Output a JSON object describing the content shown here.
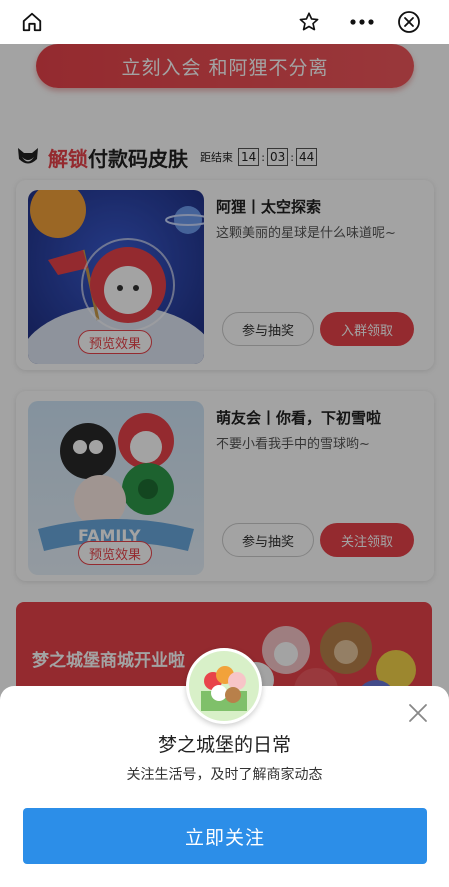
{
  "nav": {
    "home_icon": "home-icon",
    "star_icon": "star-icon",
    "more_icon": "more-icon",
    "close_icon": "close-circle-icon"
  },
  "join": {
    "label": "立刻入会 和阿狸不分离"
  },
  "section": {
    "title_highlight": "解锁",
    "title_rest": "付款码皮肤",
    "countdown_label": "距结束",
    "hours": "14",
    "minutes": "03",
    "seconds": "44"
  },
  "cards": [
    {
      "title": "阿狸丨太空探索",
      "subtitle": "这颗美丽的星球是什么味道呢~",
      "preview": "预览效果",
      "lottery": "参与抽奖",
      "action": "入群领取"
    },
    {
      "title": "萌友会丨你看，下初雪啦",
      "subtitle": "不要小看我手中的雪球哟~",
      "preview": "预览效果",
      "lottery": "参与抽奖",
      "action": "关注领取"
    }
  ],
  "banner": {
    "text": "梦之城堡商城开业啦"
  },
  "sheet": {
    "title": "梦之城堡的日常",
    "subtitle": "关注生活号，及时了解商家动态",
    "button": "立即关注"
  },
  "colors": {
    "accent": "#e8434a",
    "primary_button": "#2c8ee8"
  }
}
